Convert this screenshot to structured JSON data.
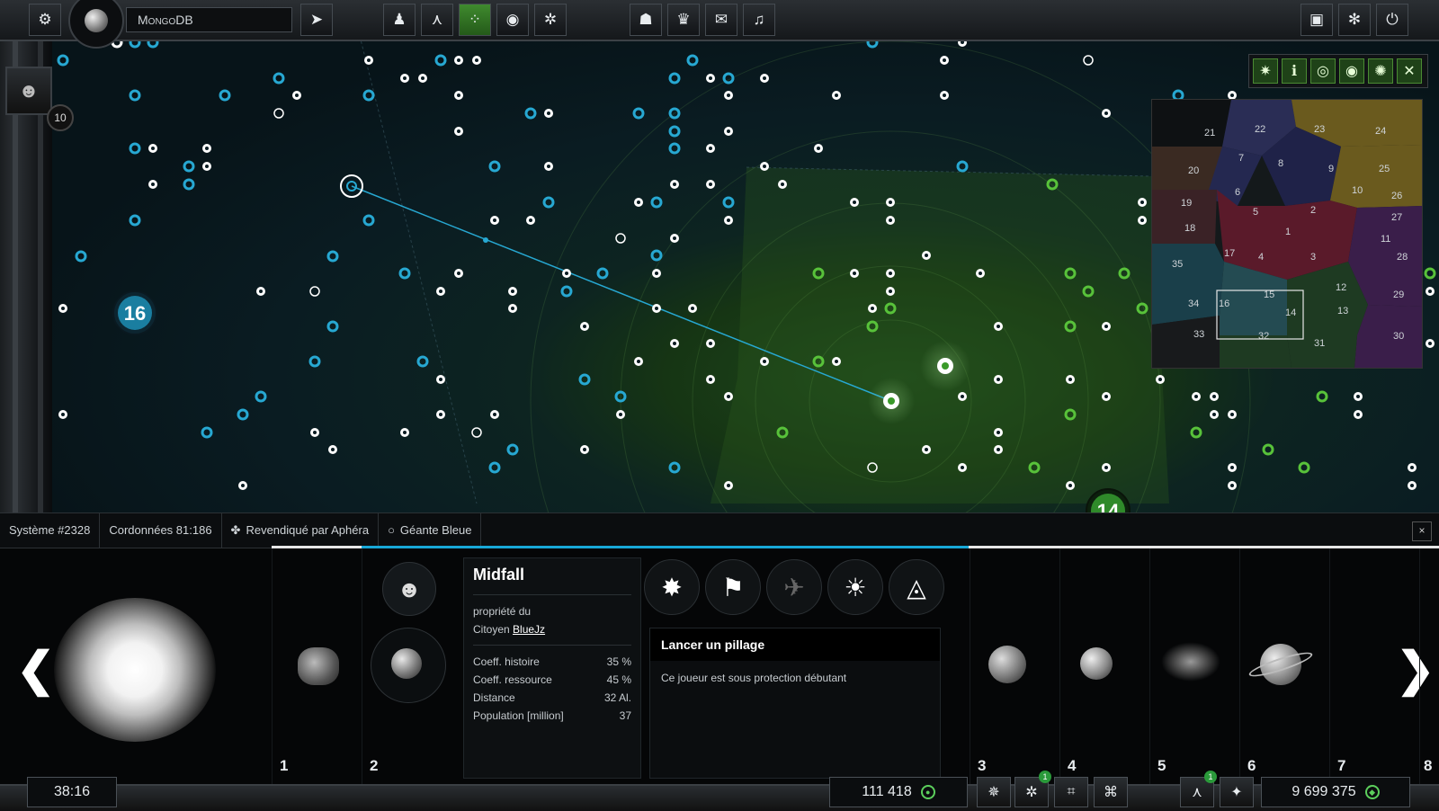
{
  "topbar": {
    "search_value": "MongoDB",
    "left_icons": [
      "settings-icon"
    ],
    "center_icons": [
      "profile-icon",
      "fleet-icon",
      "galaxy-map-icon",
      "ranking-icon",
      "faction-icon"
    ],
    "social_icons": [
      "alliance-icon",
      "trophy-icon",
      "mail-icon",
      "bell-icon"
    ],
    "right_icons": [
      "lock-icon",
      "bug-icon",
      "power-icon"
    ]
  },
  "player": {
    "level": "10"
  },
  "map": {
    "sector_badges": [
      {
        "label": "16",
        "color": "#1a7ea0"
      },
      {
        "label": "14",
        "color": "#2f8a2a"
      }
    ],
    "view_tools": [
      "star-icon",
      "info-icon",
      "target-icon",
      "eye-icon",
      "gear-flower-icon",
      "cross-icon"
    ]
  },
  "minimap": {
    "sectors": [
      "21",
      "22",
      "23",
      "24",
      "20",
      "7",
      "8",
      "9",
      "25",
      "6",
      "10",
      "26",
      "19",
      "5",
      "2",
      "27",
      "18",
      "1",
      "11",
      "17",
      "4",
      "3",
      "28",
      "35",
      "15",
      "12",
      "34",
      "16",
      "14",
      "13",
      "29",
      "33",
      "32",
      "31",
      "30"
    ]
  },
  "infobar": {
    "system": "Système #2328",
    "coords": "Cordonnées 81:186",
    "claimed": "Revendiqué par Aphéra",
    "star_type": "Géante Bleue",
    "close": "×"
  },
  "progress": {
    "fraction": 0.52
  },
  "system": {
    "slots": [
      "1",
      "2",
      "3",
      "4",
      "5",
      "6",
      "7",
      "8"
    ],
    "prev": "❮",
    "next": "❯"
  },
  "planet_panel": {
    "name": "Midfall",
    "owner_prefix": "propriété du",
    "owner_rank": "Citoyen",
    "owner_name": "BlueJz",
    "stats": [
      {
        "label": "Coeff. histoire",
        "value": "35 %"
      },
      {
        "label": "Coeff. ressource",
        "value": "45 %"
      },
      {
        "label": "Distance",
        "value": "32 Al."
      },
      {
        "label": "Population [million]",
        "value": "37"
      }
    ]
  },
  "actions": {
    "icons": [
      "burst-icon",
      "flag-icon",
      "ship-icon",
      "radiate-icon",
      "eye-triangle-icon"
    ],
    "tooltip_title": "Lancer un pillage",
    "tooltip_body": "Ce joueur est sous protection débutant"
  },
  "bottombar": {
    "clock": "38:16",
    "credits": "111 418",
    "credits_icon": "credits-icon",
    "notif_1": "1",
    "notif_2": "1",
    "resource": "9 699 375",
    "resource_icon": "resource-icon"
  }
}
